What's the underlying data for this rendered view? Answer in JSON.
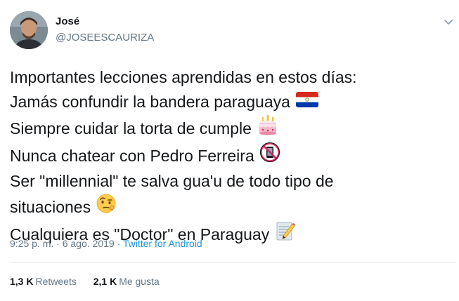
{
  "author": {
    "name": "José",
    "handle": "@JOSEESCAURIZA"
  },
  "tweet": {
    "lines": [
      "Importantes lecciones aprendidas en estos días:",
      "Jamás confundir la bandera paraguaya",
      "Siempre cuidar la torta de cumple",
      "Nunca chatear con Pedro Ferreira",
      "Ser \"millennial\" te salva gua'u de todo tipo de",
      "situaciones",
      "Cualquiera es \"Doctor\" en Paraguay"
    ],
    "emojis": [
      "paraguay-flag",
      "birthday-cake",
      "no-mobile-phones",
      "face-with-raised-eyebrow",
      "memo"
    ]
  },
  "meta": {
    "time": "9:25 p. m.",
    "separator": " · ",
    "date": "6 ago. 2019",
    "source": "Twitter for Android"
  },
  "stats": {
    "retweets_count": "1,3 K",
    "retweets_label": "Retweets",
    "likes_count": "2,1 K",
    "likes_label": "Me gusta"
  },
  "colors": {
    "text": "#14171a",
    "secondary": "#657786",
    "link": "#1b95e0",
    "divider": "#e6ecf0"
  }
}
